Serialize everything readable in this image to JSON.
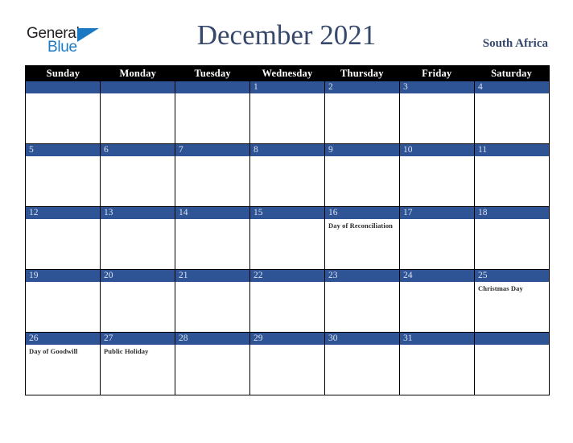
{
  "brand": {
    "word_one": "General",
    "word_two": "Blue",
    "triangle_icon": "triangle-icon",
    "accent_color": "#1b79c3",
    "text_color": "#231f20"
  },
  "header": {
    "title": "December 2021",
    "region": "South Africa",
    "title_color": "#36486b"
  },
  "calendar": {
    "header_background": "#000000",
    "day_bar_color": "#2f5496",
    "weekdays": [
      "Sunday",
      "Monday",
      "Tuesday",
      "Wednesday",
      "Thursday",
      "Friday",
      "Saturday"
    ],
    "weeks": [
      [
        {
          "day": "",
          "event": ""
        },
        {
          "day": "",
          "event": ""
        },
        {
          "day": "",
          "event": ""
        },
        {
          "day": "1",
          "event": ""
        },
        {
          "day": "2",
          "event": ""
        },
        {
          "day": "3",
          "event": ""
        },
        {
          "day": "4",
          "event": ""
        }
      ],
      [
        {
          "day": "5",
          "event": ""
        },
        {
          "day": "6",
          "event": ""
        },
        {
          "day": "7",
          "event": ""
        },
        {
          "day": "8",
          "event": ""
        },
        {
          "day": "9",
          "event": ""
        },
        {
          "day": "10",
          "event": ""
        },
        {
          "day": "11",
          "event": ""
        }
      ],
      [
        {
          "day": "12",
          "event": ""
        },
        {
          "day": "13",
          "event": ""
        },
        {
          "day": "14",
          "event": ""
        },
        {
          "day": "15",
          "event": ""
        },
        {
          "day": "16",
          "event": "Day of Reconciliation"
        },
        {
          "day": "17",
          "event": ""
        },
        {
          "day": "18",
          "event": ""
        }
      ],
      [
        {
          "day": "19",
          "event": ""
        },
        {
          "day": "20",
          "event": ""
        },
        {
          "day": "21",
          "event": ""
        },
        {
          "day": "22",
          "event": ""
        },
        {
          "day": "23",
          "event": ""
        },
        {
          "day": "24",
          "event": ""
        },
        {
          "day": "25",
          "event": "Christmas Day"
        }
      ],
      [
        {
          "day": "26",
          "event": "Day of Goodwill"
        },
        {
          "day": "27",
          "event": "Public Holiday"
        },
        {
          "day": "28",
          "event": ""
        },
        {
          "day": "29",
          "event": ""
        },
        {
          "day": "30",
          "event": ""
        },
        {
          "day": "31",
          "event": ""
        },
        {
          "day": "",
          "event": ""
        }
      ]
    ]
  }
}
